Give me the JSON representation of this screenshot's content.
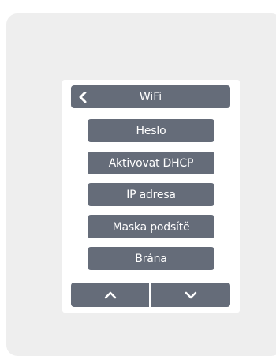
{
  "header": {
    "title": "WiFi",
    "back_icon": "chevron-left-icon"
  },
  "menu": {
    "items": [
      {
        "label": "Heslo"
      },
      {
        "label": "Aktivovat DHCP"
      },
      {
        "label": "IP adresa"
      },
      {
        "label": "Maska podsítě"
      },
      {
        "label": "Brána"
      }
    ]
  },
  "navigation": {
    "up_icon": "chevron-up-icon",
    "down_icon": "chevron-down-icon"
  },
  "colors": {
    "button": "#656c79",
    "device_background": "#eeeeee",
    "screen_background": "#ffffff",
    "text": "#ffffff"
  }
}
